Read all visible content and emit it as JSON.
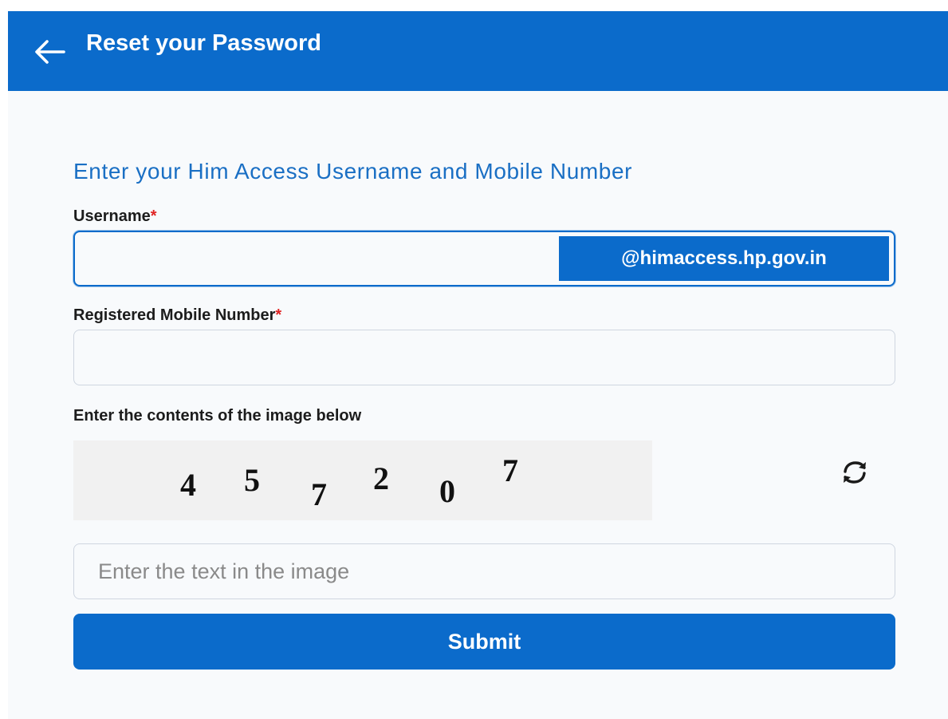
{
  "header": {
    "title": "Reset your Password",
    "back_icon": "arrow-left-icon"
  },
  "form": {
    "heading": "Enter your Him Access Username and Mobile Number",
    "required_marker": "*",
    "username": {
      "label": "Username",
      "value": "",
      "domain_suffix": "@himaccess.hp.gov.in"
    },
    "mobile": {
      "label": "Registered Mobile Number",
      "value": ""
    },
    "captcha": {
      "label": "Enter the contents of the image below",
      "characters": [
        "4",
        "5",
        "7",
        "2",
        "0",
        "7"
      ],
      "refresh_icon": "refresh-icon",
      "input_placeholder": "Enter the text in the image",
      "input_value": ""
    },
    "submit_label": "Submit"
  },
  "colors": {
    "primary": "#0b6bcb",
    "heading": "#1a6fc4",
    "required": "#e02424",
    "page_background": "#f8fafc"
  }
}
